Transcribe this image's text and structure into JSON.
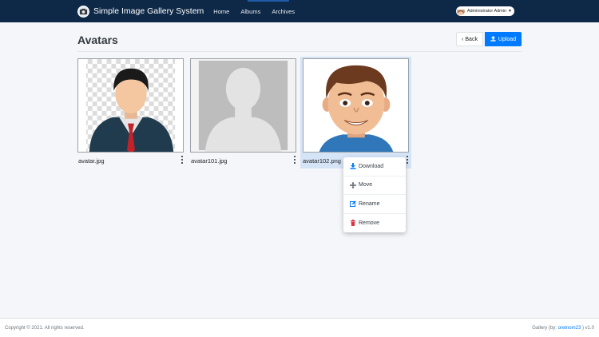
{
  "navbar": {
    "brand": "Simple Image Gallery System",
    "links": [
      "Home",
      "Albums",
      "Archives"
    ],
    "user": "Administrator Admin"
  },
  "header": {
    "title": "Avatars",
    "back_label": "Back",
    "upload_label": "Upload"
  },
  "gallery": {
    "items": [
      {
        "name": "avatar.jpg"
      },
      {
        "name": "avatar101.jpg"
      },
      {
        "name": "avatar102.png"
      }
    ]
  },
  "menu": {
    "items": [
      "Download",
      "Move",
      "Rename",
      "Remove"
    ]
  },
  "footer": {
    "copyright": "Copyright © 2021. All rights reserved.",
    "credit_prefix": "Gallery (by: ",
    "credit_author": "oretnom23",
    "credit_suffix": " ) v1.0"
  },
  "colors": {
    "navbar": "#0e2847",
    "primary": "#007bff",
    "selected": "#d6e4f7",
    "danger": "#dc3545"
  }
}
